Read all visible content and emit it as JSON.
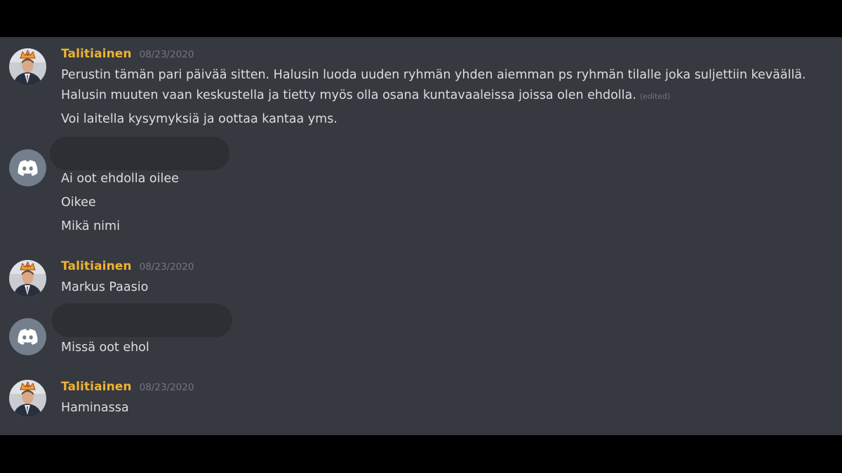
{
  "colors": {
    "background": "#36393f",
    "frame": "#000000",
    "username": "#f0b232",
    "text": "#dcddde",
    "muted": "#72767d",
    "discord_avatar": "#747f8d"
  },
  "messages": [
    {
      "author": "Talitiainen",
      "avatar": "crowned-person-avatar",
      "timestamp": "08/23/2020",
      "lines": [
        "Perustin tämän pari päivää sitten. Halusin luoda uuden ryhmän yhden aiemman ps ryhmän tilalle joka suljettiin keväällä.",
        "Halusin muuten vaan keskustella ja tietty myös olla osana kuntavaaleissa joissa olen ehdolla.",
        "Voi laitella kysymyksiä ja oottaa kantaa yms."
      ],
      "edited_label": "(edited)"
    },
    {
      "author": "",
      "avatar": "discord-default-avatar",
      "lines": [
        "Ai oot ehdolla oilee",
        "Oikee",
        "Mikä nimi"
      ]
    },
    {
      "author": "Talitiainen",
      "avatar": "crowned-person-avatar",
      "timestamp": "08/23/2020",
      "lines": [
        "Markus Paasio"
      ]
    },
    {
      "author": "",
      "avatar": "discord-default-avatar",
      "lines": [
        "Missä oot ehol"
      ]
    },
    {
      "author": "Talitiainen",
      "avatar": "crowned-person-avatar",
      "timestamp": "08/23/2020",
      "lines": [
        "Haminassa"
      ]
    }
  ]
}
